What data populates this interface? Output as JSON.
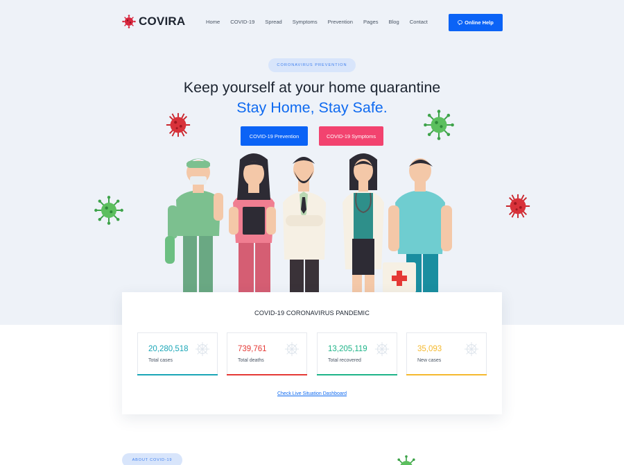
{
  "brand": {
    "name": "COVIRA",
    "icon": "virus-logo-icon",
    "accent": "#d7263d"
  },
  "nav": {
    "items": [
      "Home",
      "COVID-19",
      "Spread",
      "Symptoms",
      "Prevention",
      "Pages",
      "Blog",
      "Contact"
    ],
    "help_button": "Online Help",
    "help_icon": "chat-icon"
  },
  "hero": {
    "tag": "CORONAVIRUS PREVENTION",
    "title": "Keep yourself at your home quarantine",
    "subtitle": "Stay Home, Stay Safe.",
    "primary_button": "COVID-19 Prevention",
    "secondary_button": "COVID-19 Symptoms",
    "colors": {
      "primary": "#0b63f6",
      "secondary": "#f2436f",
      "background": "#eef2f8"
    }
  },
  "stats": {
    "title": "COVID-19 CORONAVIRUS PANDEMIC",
    "items": [
      {
        "value": "20,280,518",
        "label": "Total cases",
        "color": "#1aa6b7"
      },
      {
        "value": "739,761",
        "label": "Total deaths",
        "color": "#e53935"
      },
      {
        "value": "13,205,119",
        "label": "Total recovered",
        "color": "#1fb489"
      },
      {
        "value": "35,093",
        "label": "New cases",
        "color": "#f5b92e"
      }
    ],
    "link": "Check Live Situation Dashboard"
  },
  "about": {
    "tag": "ABOUT COVID-19"
  }
}
